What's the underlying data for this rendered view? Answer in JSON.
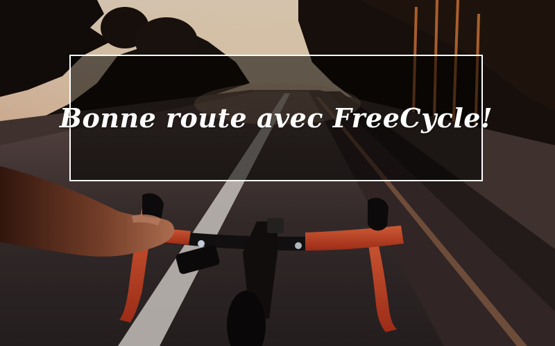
{
  "banner": {
    "text": "Bonne route avec FreeCycle!"
  },
  "photo": {
    "subject": "cyclist hands on road bike handlebars at sunset",
    "colors": {
      "sky": "#f4d7b8",
      "road": "#3a2f2f",
      "lane_line": "#d8d4d0",
      "bar_tape": "#e2512e",
      "foliage": "#1c1410"
    }
  }
}
